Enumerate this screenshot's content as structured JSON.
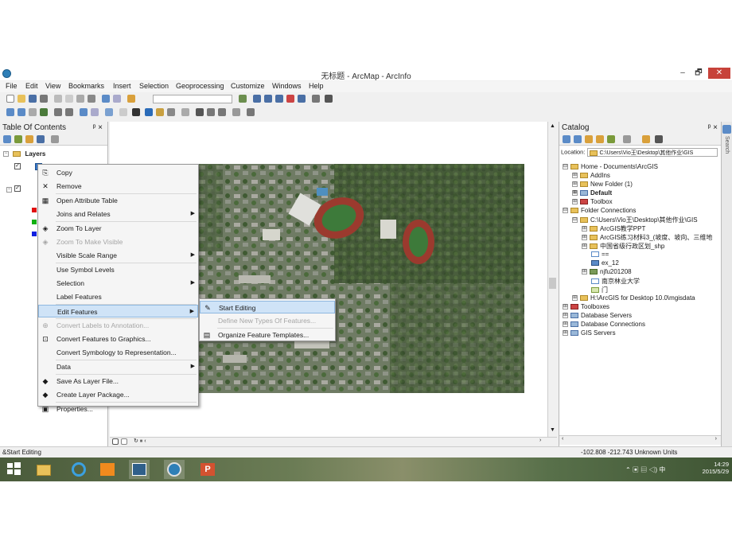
{
  "window": {
    "title": "无标题 - ArcMap - ArcInfo",
    "min": "–",
    "restore": "🗗",
    "close": "✕"
  },
  "menubar": [
    "File",
    "Edit",
    "View",
    "Bookmarks",
    "Insert",
    "Selection",
    "Geoprocessing",
    "Customize",
    "Windows",
    "Help"
  ],
  "toc": {
    "title": "Table Of Contents",
    "pin": "ᵖ ×",
    "layers_label": "Layers"
  },
  "context_menu": [
    {
      "label": "Copy",
      "icon": "copy-icon",
      "glyph": "⎘",
      "disabled": false
    },
    {
      "label": "Remove",
      "icon": "remove-icon",
      "glyph": "✕",
      "disabled": false
    },
    {
      "label": "Open Attribute Table",
      "icon": "table-icon",
      "glyph": "▦",
      "disabled": false
    },
    {
      "label": "Joins and Relates",
      "icon": "",
      "glyph": "",
      "disabled": false,
      "submenu": true
    },
    {
      "label": "Zoom To Layer",
      "icon": "zoom-layer-icon",
      "glyph": "◈",
      "disabled": false
    },
    {
      "label": "Zoom To Make Visible",
      "icon": "zoom-visible-icon",
      "glyph": "◈",
      "disabled": true
    },
    {
      "label": "Visible Scale Range",
      "icon": "",
      "glyph": "",
      "disabled": false,
      "submenu": true
    },
    {
      "label": "Use Symbol Levels",
      "icon": "",
      "glyph": "",
      "disabled": false
    },
    {
      "label": "Selection",
      "icon": "",
      "glyph": "",
      "disabled": false,
      "submenu": true
    },
    {
      "label": "Label Features",
      "icon": "",
      "glyph": "",
      "disabled": false
    },
    {
      "label": "Edit Features",
      "icon": "",
      "glyph": "",
      "disabled": false,
      "submenu": true,
      "highlighted": true
    },
    {
      "label": "Convert Labels to Annotation...",
      "icon": "convert-labels-icon",
      "glyph": "⊕",
      "disabled": true
    },
    {
      "label": "Convert Features to Graphics...",
      "icon": "convert-graphics-icon",
      "glyph": "⊡",
      "disabled": false
    },
    {
      "label": "Convert Symbology to Representation...",
      "icon": "",
      "glyph": "",
      "disabled": false
    },
    {
      "label": "Data",
      "icon": "",
      "glyph": "",
      "disabled": false,
      "submenu": true
    },
    {
      "label": "Save As Layer File...",
      "icon": "layer-file-icon",
      "glyph": "◆",
      "disabled": false
    },
    {
      "label": "Create Layer Package...",
      "icon": "layer-package-icon",
      "glyph": "◆",
      "disabled": false
    },
    {
      "label": "Properties...",
      "icon": "properties-icon",
      "glyph": "▣",
      "disabled": false
    }
  ],
  "submenu": [
    {
      "label": "Start Editing",
      "icon": "pencil-icon",
      "glyph": "✎",
      "disabled": false,
      "highlighted": true
    },
    {
      "label": "Define New Types Of Features...",
      "icon": "",
      "glyph": "",
      "disabled": true
    },
    {
      "label": "Organize Feature Templates...",
      "icon": "templates-icon",
      "glyph": "▤",
      "disabled": false
    }
  ],
  "catalog": {
    "title": "Catalog",
    "pin": "ᵖ ×",
    "location_label": "Location:",
    "location_value": "C:\\Users\\Vio王\\Desktop\\其他作业\\GIS",
    "items": [
      {
        "label": "Home - Documents\\ArcGIS",
        "indent": 0,
        "expander": "⊟",
        "bold": false
      },
      {
        "label": "AddIns",
        "indent": 1,
        "expander": "⊞",
        "bold": false
      },
      {
        "label": "New Folder (1)",
        "indent": 1,
        "expander": "⊞",
        "bold": false
      },
      {
        "label": "Default",
        "indent": 1,
        "expander": "⊞",
        "bold": true
      },
      {
        "label": "Toolbox",
        "indent": 1,
        "expander": "⊞",
        "bold": false
      },
      {
        "label": "Folder Connections",
        "indent": 0,
        "expander": "⊟",
        "bold": false
      },
      {
        "label": "C:\\Users\\Vio王\\Desktop\\其他作业\\GIS",
        "indent": 1,
        "expander": "⊟",
        "bold": false
      },
      {
        "label": "ArcGIS教学PPT",
        "indent": 2,
        "expander": "⊞",
        "bold": false
      },
      {
        "label": "ArcGIS练习材料3_(坡度、坡向、三维地",
        "indent": 2,
        "expander": "⊞",
        "bold": false
      },
      {
        "label": "中国省级行政区划_shp",
        "indent": 2,
        "expander": "⊞",
        "bold": false
      },
      {
        "label": "==",
        "indent": 2,
        "expander": "",
        "bold": false
      },
      {
        "label": "ex_12",
        "indent": 2,
        "expander": "",
        "bold": false
      },
      {
        "label": "njfu201208",
        "indent": 2,
        "expander": "⊞",
        "bold": false
      },
      {
        "label": "南京林业大学",
        "indent": 2,
        "expander": "",
        "bold": false
      },
      {
        "label": "门",
        "indent": 2,
        "expander": "",
        "bold": false
      },
      {
        "label": "H:\\ArcGIS for Desktop 10.0\\mgisdata",
        "indent": 1,
        "expander": "⊞",
        "bold": false
      },
      {
        "label": "Toolboxes",
        "indent": 0,
        "expander": "⊞",
        "bold": false
      },
      {
        "label": "Database Servers",
        "indent": 0,
        "expander": "⊞",
        "bold": false
      },
      {
        "label": "Database Connections",
        "indent": 0,
        "expander": "⊞",
        "bold": false
      },
      {
        "label": "GIS Servers",
        "indent": 0,
        "expander": "⊞",
        "bold": false
      }
    ]
  },
  "status": {
    "left": "&Start Editing",
    "coords": "-102.808  -212.743 Unknown Units"
  },
  "search_tab": "Search",
  "taskbar": {
    "time": "14:29",
    "date": "2015/5/29"
  },
  "colors": {
    "highlight": "#cfe3f7",
    "close": "#c7423a",
    "map_bg": "#6d7a62"
  }
}
